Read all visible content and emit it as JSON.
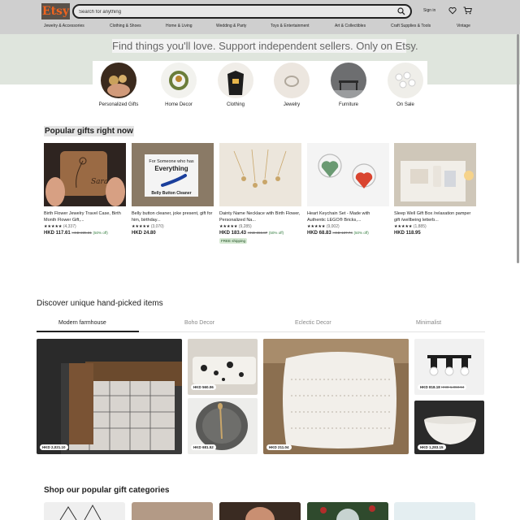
{
  "header": {
    "logo": "Etsy",
    "search_placeholder": "Search for anything",
    "signin": "Sign in",
    "categories": [
      "Jewelry & Accessories",
      "Clothing & Shoes",
      "Home & Living",
      "Wedding & Party",
      "Toys & Entertainment",
      "Art & Collectibles",
      "Craft Supplies & Tools",
      "Vintage"
    ]
  },
  "hero": {
    "headline": "Find things you'll love. Support independent sellers. Only on Etsy.",
    "circles": [
      "Personalized Gifts",
      "Home Decor",
      "Clothing",
      "Jewelry",
      "Furniture",
      "On Sale"
    ]
  },
  "popular": {
    "title": "Popular gifts right now",
    "items": [
      {
        "title": "Birth Flower Jewelry Travel Case, Birth Month Flower Gift,...",
        "stars": "★★★★★",
        "count": "(4,337)",
        "price": "HKD 117.61",
        "orig": "HKD 235.31",
        "off": "(50% off)"
      },
      {
        "title": "Belly button cleaner, joke present, gift for him, birthday...",
        "stars": "★★★★★",
        "count": "(3,070)",
        "price": "HKD 24.80",
        "orig": "",
        "off": ""
      },
      {
        "title": "Dainty Name Necklace with Birth Flower, Personalized Na...",
        "stars": "★★★★★",
        "count": "(9,285)",
        "price": "HKD 183.43",
        "orig": "HKD 366.87",
        "off": "(50% off)"
      },
      {
        "title": "Heart Keychain Set - Made with Authentic LEGO® Bricks,...",
        "stars": "★★★★★",
        "count": "(9,002)",
        "price": "HKD 68.83",
        "orig": "HKD 137.74",
        "off": "(50% off)"
      },
      {
        "title": "Sleep Well Gift Box /relaxation pamper gift /wellbeing letterb...",
        "stars": "★★★★★",
        "count": "(1,885)",
        "price": "HKD 118.95",
        "orig": "",
        "off": ""
      }
    ],
    "free_shipping": "FREE shipping",
    "img_text_name": "Sarah",
    "img_text_someone": "For Someone who has",
    "img_text_everything": "Everything",
    "img_text_belly": "Belly Button Cleaner"
  },
  "discover": {
    "title": "Discover unique hand-picked items",
    "tabs": [
      "Modern farmhouse",
      "Boho Decor",
      "Eclectic Decor",
      "Minimalist"
    ],
    "prices": {
      "stool": "HKD 2,021.10",
      "plate": "HKD 560.06",
      "tray": "HKD 681.52",
      "pillow": "HKD 211.04",
      "lamp": "HKD 818.18",
      "lamp_orig": "HKD 1,363.64",
      "bowl": "HKD 1,283.15"
    }
  },
  "shop": {
    "title": "Shop our popular gift categories"
  },
  "colors": {
    "accent": "#f1641e",
    "hero_bg": "#dfe5dd",
    "header_bg": "#cfcfcf",
    "sale_green": "#2f7a3b"
  }
}
